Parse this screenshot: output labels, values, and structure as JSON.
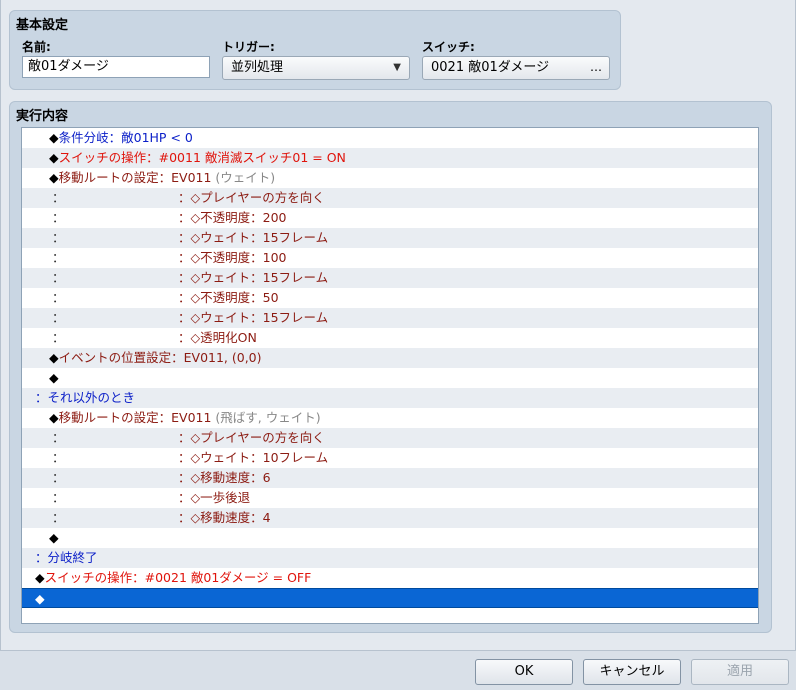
{
  "basic": {
    "title": "基本設定",
    "name_label": "名前:",
    "name_value": "敵01ダメージ",
    "trigger_label": "トリガー:",
    "trigger_value": "並列処理",
    "switch_label": "スイッチ:",
    "switch_value": "0021 敵01ダメージ",
    "switch_button": "…"
  },
  "exec": {
    "title": "実行内容",
    "rows": [
      {
        "prefix": "◆",
        "parts": [
          {
            "text": "条件分岐：敵01HP < 0",
            "color": "blue"
          }
        ]
      },
      {
        "prefix": "◆",
        "parts": [
          {
            "text": "スイッチの操作：#0011 敵消滅スイッチ01 = ON",
            "color": "red"
          }
        ]
      },
      {
        "prefix": "◆",
        "parts": [
          {
            "text": "移動ルートの設定：EV011",
            "color": "dred"
          },
          {
            "text": " (ウェイト)",
            "color": "gray"
          }
        ]
      },
      {
        "prefix": "：",
        "detail": "：◇プレイヤーの方を向く"
      },
      {
        "prefix": "：",
        "detail": "：◇不透明度：200"
      },
      {
        "prefix": "：",
        "detail": "：◇ウェイト：15フレーム"
      },
      {
        "prefix": "：",
        "detail": "：◇不透明度：100"
      },
      {
        "prefix": "：",
        "detail": "：◇ウェイト：15フレーム"
      },
      {
        "prefix": "：",
        "detail": "：◇不透明度：50"
      },
      {
        "prefix": "：",
        "detail": "：◇ウェイト：15フレーム"
      },
      {
        "prefix": "：",
        "detail": "：◇透明化ON"
      },
      {
        "prefix": "◆",
        "parts": [
          {
            "text": "イベントの位置設定：EV011, (0,0)",
            "color": "dred"
          }
        ]
      },
      {
        "prefix": "◆",
        "parts": []
      },
      {
        "prefix": "",
        "parts": [
          {
            "text": "：それ以外のとき",
            "color": "blue"
          }
        ],
        "outer": true
      },
      {
        "prefix": "◆",
        "parts": [
          {
            "text": "移動ルートの設定：EV011",
            "color": "dred"
          },
          {
            "text": " (飛ばす, ウェイト)",
            "color": "gray"
          }
        ]
      },
      {
        "prefix": "：",
        "detail": "：◇プレイヤーの方を向く"
      },
      {
        "prefix": "：",
        "detail": "：◇ウェイト：10フレーム"
      },
      {
        "prefix": "：",
        "detail": "：◇移動速度：6"
      },
      {
        "prefix": "：",
        "detail": "：◇一歩後退"
      },
      {
        "prefix": "：",
        "detail": "：◇移動速度：4"
      },
      {
        "prefix": "◆",
        "parts": []
      },
      {
        "prefix": "",
        "parts": [
          {
            "text": "：分岐終了",
            "color": "blue"
          }
        ],
        "outer": true
      },
      {
        "prefix": "◆",
        "parts": [
          {
            "text": "スイッチの操作：#0021 敵01ダメージ = OFF",
            "color": "red"
          }
        ],
        "outer": true
      },
      {
        "prefix": "◆",
        "parts": [],
        "outer": true,
        "selected": true
      }
    ]
  },
  "buttons": {
    "ok": "OK",
    "cancel": "キャンセル",
    "apply": "適用"
  }
}
